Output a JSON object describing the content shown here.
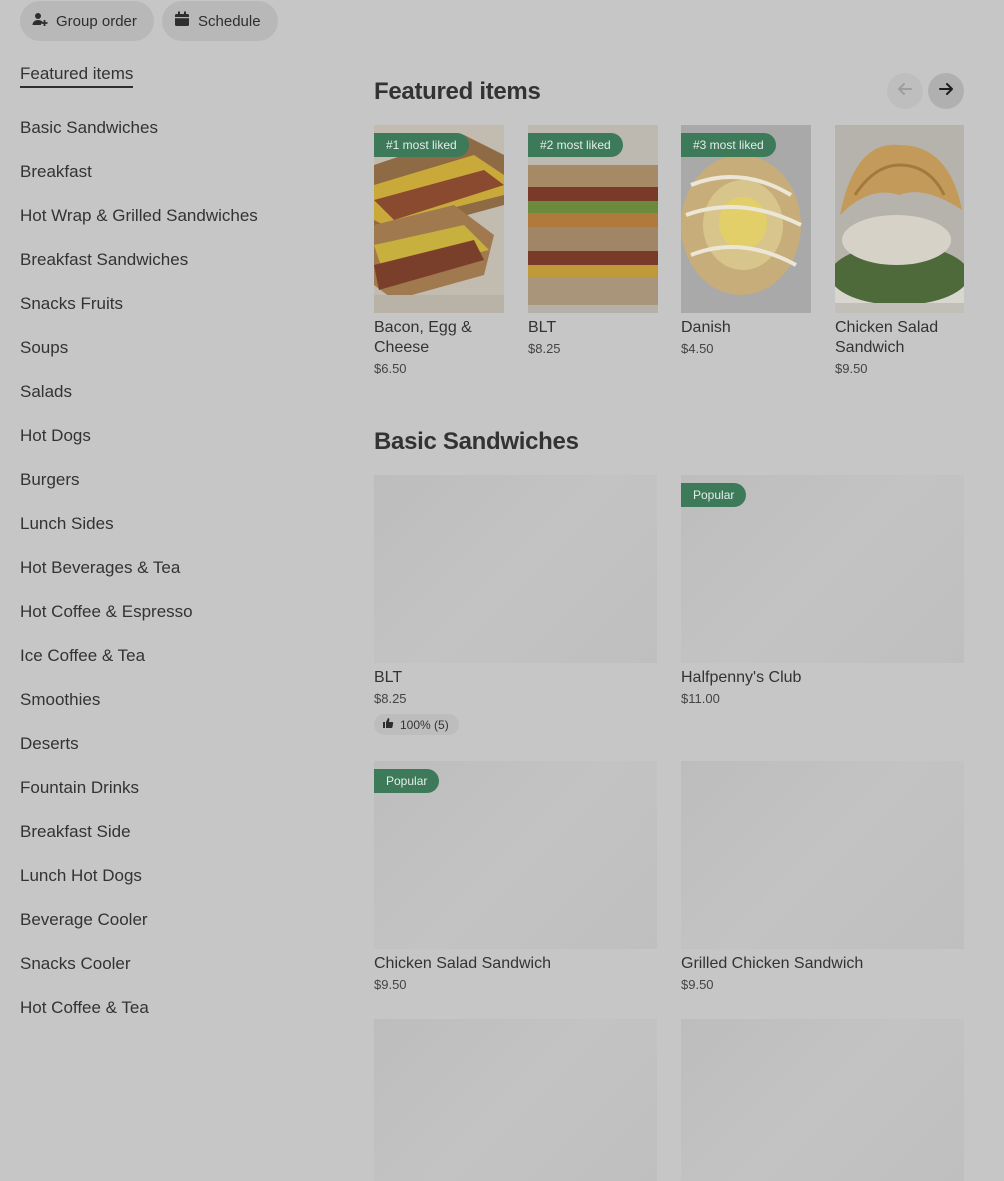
{
  "top_actions": {
    "group_order": "Group order",
    "schedule": "Schedule"
  },
  "sidebar": {
    "items": [
      {
        "label": "Featured items"
      },
      {
        "label": "Basic Sandwiches"
      },
      {
        "label": "Breakfast"
      },
      {
        "label": "Hot Wrap & Grilled Sandwiches"
      },
      {
        "label": "Breakfast Sandwiches"
      },
      {
        "label": "Snacks Fruits"
      },
      {
        "label": "Soups"
      },
      {
        "label": "Salads"
      },
      {
        "label": "Hot Dogs"
      },
      {
        "label": "Burgers"
      },
      {
        "label": "Lunch Sides"
      },
      {
        "label": "Hot Beverages & Tea"
      },
      {
        "label": "Hot Coffee & Espresso"
      },
      {
        "label": "Ice Coffee & Tea"
      },
      {
        "label": "Smoothies"
      },
      {
        "label": "Deserts"
      },
      {
        "label": "Fountain Drinks"
      },
      {
        "label": "Breakfast Side"
      },
      {
        "label": "Lunch Hot Dogs"
      },
      {
        "label": "Beverage Cooler"
      },
      {
        "label": "Snacks Cooler"
      },
      {
        "label": "Hot Coffee & Tea"
      }
    ]
  },
  "featured": {
    "title": "Featured items",
    "items": [
      {
        "badge": "#1 most liked",
        "name": "Bacon, Egg & Cheese",
        "price": "$6.50"
      },
      {
        "badge": "#2 most liked",
        "name": "BLT",
        "price": "$8.25"
      },
      {
        "badge": "#3 most liked",
        "name": "Danish",
        "price": "$4.50"
      },
      {
        "badge": "",
        "name": "Chicken Salad Sandwich",
        "price": "$9.50"
      }
    ]
  },
  "basic_sandwiches": {
    "title": "Basic Sandwiches",
    "items": [
      {
        "name": "BLT",
        "price": "$8.25",
        "badge": "",
        "rating": "100% (5)"
      },
      {
        "name": "Halfpenny's Club",
        "price": "$11.00",
        "badge": "Popular",
        "rating": ""
      },
      {
        "name": "Chicken Salad Sandwich",
        "price": "$9.50",
        "badge": "Popular",
        "rating": ""
      },
      {
        "name": "Grilled Chicken Sandwich",
        "price": "$9.50",
        "badge": "",
        "rating": ""
      },
      {
        "name": "",
        "price": "",
        "badge": "",
        "rating": ""
      },
      {
        "name": "",
        "price": "",
        "badge": "",
        "rating": ""
      }
    ]
  },
  "colors": {
    "badge_green": "#3d7a5a",
    "overlay_gray": "#c6c6c6"
  }
}
